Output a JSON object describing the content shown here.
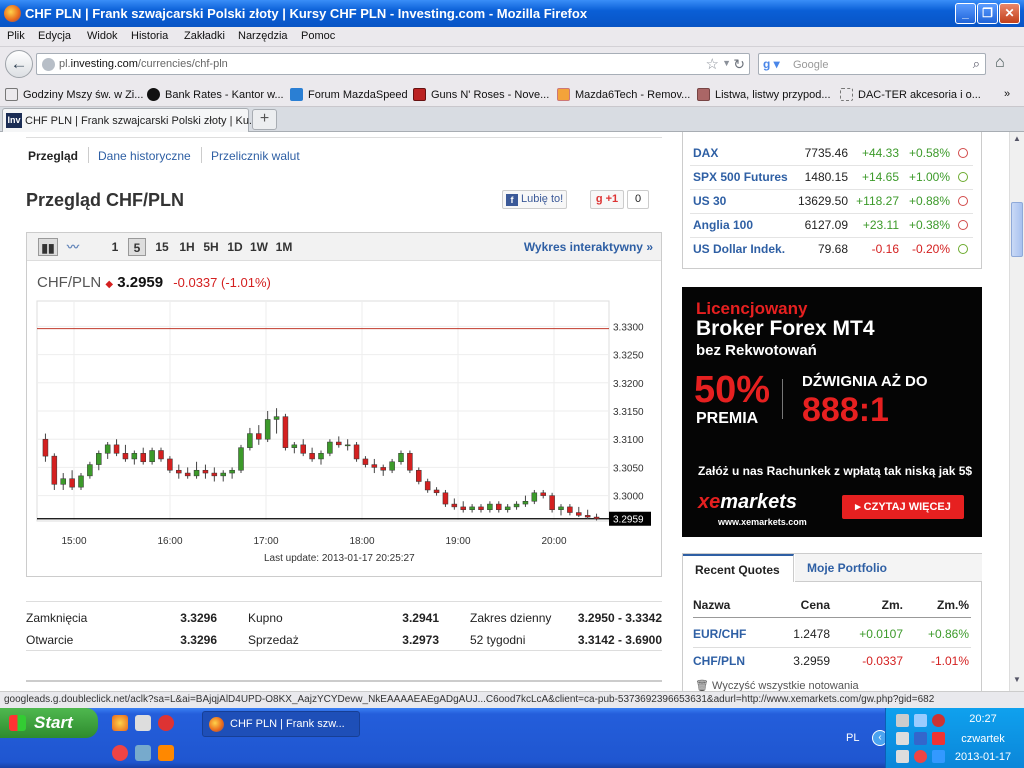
{
  "window": {
    "title": "CHF PLN | Frank szwajcarski Polski złoty | Kursy CHF PLN - Investing.com - Mozilla Firefox"
  },
  "menu": [
    "Plik",
    "Edycja",
    "Widok",
    "Historia",
    "Zakładki",
    "Narzędzia",
    "Pomoc"
  ],
  "address": {
    "prefix": "pl.",
    "host": "investing.com",
    "path": "/currencies/chf-pln"
  },
  "search": {
    "placeholder": "Google"
  },
  "bookmarks": [
    "Godziny Mszy św. w Zi...",
    "Bank Rates - Kantor w...",
    "Forum MazdaSpeed",
    "Guns N' Roses - Nove...",
    "Mazda6Tech - Remov...",
    "Listwa, listwy przypod...",
    "DAC-TER akcesoria i o..."
  ],
  "tab": {
    "favicon": "Inv",
    "label": "CHF PLN | Frank szwajcarski Polski złoty | Ku..."
  },
  "subnav": {
    "overview": "Przegląd",
    "history": "Dane historyczne",
    "converter": "Przelicznik walut"
  },
  "page_title": "Przegląd CHF/PLN",
  "social": {
    "like": "Lubię to!",
    "gplus": "+1",
    "count": "0"
  },
  "chart_toolbar": {
    "intervals": [
      "1",
      "5",
      "15",
      "1H",
      "5H",
      "1D",
      "1W",
      "1M"
    ],
    "selected": "5",
    "interactive": "Wykres interaktywny »"
  },
  "quote": {
    "pair": "CHF/PLN",
    "price": "3.2959",
    "change": "-0.0337 (-1.01%)"
  },
  "last_update": "Last update: 2013-01-17 20:25:27",
  "chart_data": {
    "type": "candlestick",
    "title": "CHF/PLN",
    "x_ticks": [
      "15:00",
      "16:00",
      "17:00",
      "18:00",
      "19:00",
      "20:00"
    ],
    "y_ticks": [
      "3.3300",
      "3.3250",
      "3.3200",
      "3.3150",
      "3.3100",
      "3.3050",
      "3.3000"
    ],
    "ylim": [
      3.2955,
      3.3345
    ],
    "reference_line": 3.3296,
    "last_price": 3.2959,
    "candles": [
      [
        3.31,
        3.311,
        3.306,
        3.307
      ],
      [
        3.307,
        3.3075,
        3.301,
        3.302
      ],
      [
        3.302,
        3.304,
        3.301,
        3.303
      ],
      [
        3.303,
        3.3045,
        3.301,
        3.3015
      ],
      [
        3.3015,
        3.304,
        3.301,
        3.3035
      ],
      [
        3.3035,
        3.306,
        3.303,
        3.3055
      ],
      [
        3.3055,
        3.308,
        3.3045,
        3.3075
      ],
      [
        3.3075,
        3.3095,
        3.3065,
        3.309
      ],
      [
        3.309,
        3.31,
        3.307,
        3.3075
      ],
      [
        3.3075,
        3.309,
        3.306,
        3.3065
      ],
      [
        3.3065,
        3.308,
        3.3055,
        3.3075
      ],
      [
        3.3075,
        3.3085,
        3.3055,
        3.306
      ],
      [
        3.306,
        3.3085,
        3.3055,
        3.308
      ],
      [
        3.308,
        3.3085,
        3.306,
        3.3065
      ],
      [
        3.3065,
        3.307,
        3.304,
        3.3045
      ],
      [
        3.3045,
        3.3055,
        3.303,
        3.304
      ],
      [
        3.304,
        3.305,
        3.303,
        3.3035
      ],
      [
        3.3035,
        3.306,
        3.303,
        3.3045
      ],
      [
        3.3045,
        3.3055,
        3.303,
        3.304
      ],
      [
        3.304,
        3.305,
        3.3025,
        3.3035
      ],
      [
        3.3035,
        3.3045,
        3.3025,
        3.304
      ],
      [
        3.304,
        3.305,
        3.303,
        3.3045
      ],
      [
        3.3045,
        3.309,
        3.304,
        3.3085
      ],
      [
        3.3085,
        3.312,
        3.308,
        3.311
      ],
      [
        3.311,
        3.3125,
        3.309,
        3.31
      ],
      [
        3.31,
        3.315,
        3.3095,
        3.3135
      ],
      [
        3.3135,
        3.3155,
        3.311,
        3.314
      ],
      [
        3.314,
        3.3145,
        3.308,
        3.3085
      ],
      [
        3.3085,
        3.3095,
        3.3075,
        3.309
      ],
      [
        3.309,
        3.31,
        3.307,
        3.3075
      ],
      [
        3.3075,
        3.3085,
        3.306,
        3.3065
      ],
      [
        3.3065,
        3.308,
        3.3055,
        3.3075
      ],
      [
        3.3075,
        3.31,
        3.307,
        3.3095
      ],
      [
        3.3095,
        3.3105,
        3.3085,
        3.309
      ],
      [
        3.309,
        3.31,
        3.308,
        3.309
      ],
      [
        3.309,
        3.3095,
        3.306,
        3.3065
      ],
      [
        3.3065,
        3.307,
        3.305,
        3.3055
      ],
      [
        3.3055,
        3.3065,
        3.304,
        3.305
      ],
      [
        3.305,
        3.3055,
        3.3035,
        3.3045
      ],
      [
        3.3045,
        3.3065,
        3.304,
        3.306
      ],
      [
        3.306,
        3.308,
        3.3055,
        3.3075
      ],
      [
        3.3075,
        3.308,
        3.304,
        3.3045
      ],
      [
        3.3045,
        3.305,
        3.302,
        3.3025
      ],
      [
        3.3025,
        3.303,
        3.3005,
        3.301
      ],
      [
        3.301,
        3.3015,
        3.3,
        3.3005
      ],
      [
        3.3005,
        3.301,
        3.298,
        3.2985
      ],
      [
        3.2985,
        3.2995,
        3.2975,
        3.298
      ],
      [
        3.298,
        3.299,
        3.297,
        3.2975
      ],
      [
        3.2975,
        3.2985,
        3.297,
        3.298
      ],
      [
        3.298,
        3.2985,
        3.297,
        3.2975
      ],
      [
        3.2975,
        3.299,
        3.297,
        3.2985
      ],
      [
        3.2985,
        3.299,
        3.297,
        3.2975
      ],
      [
        3.2975,
        3.2985,
        3.297,
        3.298
      ],
      [
        3.298,
        3.299,
        3.2975,
        3.2985
      ],
      [
        3.2985,
        3.3,
        3.298,
        3.299
      ],
      [
        3.299,
        3.301,
        3.2985,
        3.3005
      ],
      [
        3.3005,
        3.301,
        3.2995,
        3.3
      ],
      [
        3.3,
        3.3005,
        3.297,
        3.2975
      ],
      [
        3.2975,
        3.2985,
        3.2965,
        3.298
      ],
      [
        3.298,
        3.2985,
        3.2965,
        3.297
      ],
      [
        3.297,
        3.298,
        3.2962,
        3.2965
      ],
      [
        3.2965,
        3.2975,
        3.2958,
        3.2962
      ],
      [
        3.2962,
        3.2968,
        3.2956,
        3.2959
      ]
    ]
  },
  "stats": {
    "open_close": [
      {
        "label": "Zamknięcia",
        "value": "3.3296"
      },
      {
        "label": "Otwarcie",
        "value": "3.3296"
      }
    ],
    "bid_ask": [
      {
        "label": "Kupno",
        "value": "3.2941"
      },
      {
        "label": "Sprzedaż",
        "value": "3.2973"
      }
    ],
    "ranges": [
      {
        "label": "Zakres dzienny",
        "value": "3.2950 - 3.3342"
      },
      {
        "label": "52 tygodni",
        "value": "3.3142 - 3.6900"
      }
    ]
  },
  "indices": [
    {
      "name": "DAX",
      "value": "7735.46",
      "change": "+44.33",
      "pct": "+0.58%",
      "status": "closed"
    },
    {
      "name": "SPX 500 Futures",
      "value": "1480.15",
      "change": "+14.65",
      "pct": "+1.00%",
      "status": "open"
    },
    {
      "name": "US 30",
      "value": "13629.50",
      "change": "+118.27",
      "pct": "+0.88%",
      "status": "closed"
    },
    {
      "name": "Anglia 100",
      "value": "6127.09",
      "change": "+23.11",
      "pct": "+0.38%",
      "status": "closed"
    },
    {
      "name": "US Dollar Indek.",
      "value": "79.68",
      "change": "-0.16",
      "pct": "-0.20%",
      "status": "open"
    }
  ],
  "ad": {
    "line1": "Licencjowany",
    "line2": "Broker Forex MT4",
    "line3": "bez Rekwotowań",
    "percent": "50%",
    "premia": "PREMIA",
    "leverage_label": "DŹWIGNIA AŻ DO",
    "leverage": "888:1",
    "cta_text": "Załóż u nas Rachunkek z wpłatą tak niską jak 5$",
    "logo_a": "xe",
    "logo_b": "markets",
    "site": "www.xemarkets.com",
    "button": "▸ CZYTAJ WIĘCEJ"
  },
  "recent": {
    "tab_recent": "Recent Quotes",
    "tab_portfolio": "Moje Portfolio",
    "headers": [
      "Nazwa",
      "Cena",
      "Zm.",
      "Zm.%"
    ],
    "rows": [
      {
        "name": "EUR/CHF",
        "price": "1.2478",
        "change": "+0.0107",
        "pct": "+0.86%"
      },
      {
        "name": "CHF/PLN",
        "price": "3.2959",
        "change": "-0.0337",
        "pct": "-1.01%"
      }
    ],
    "clear": "Wyczyść wszystkie notowania"
  },
  "status_bar": "googleads.g.doubleclick.net/aclk?sa=L&ai=BAjqjAlD4UPD-O8KX_AajzYCYDevw_NkEAAAAEAEgADgAUJ...C6ood7kcLcA&client=ca-pub-5373692396653631&adurl=http://www.xemarkets.com/gw.php?gid=682",
  "taskbar": {
    "start": "Start",
    "task": "CHF PLN | Frank szw...",
    "lang": "PL",
    "time": "20:27",
    "day": "czwartek",
    "date": "2013-01-17"
  },
  "colors": {
    "up": "#3c9a2a",
    "down": "#d42020",
    "link": "#2e5fa4"
  }
}
